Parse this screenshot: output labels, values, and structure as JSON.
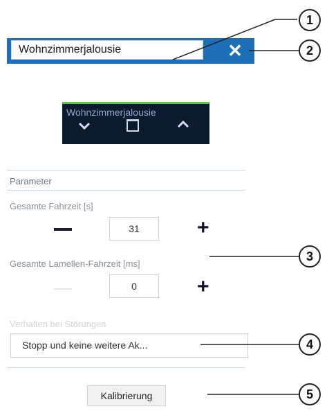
{
  "header": {
    "name_value": "Wohnzimmerjalousie",
    "close_symbol": "✕",
    "bar_color": "#1e6fb8"
  },
  "preview": {
    "title": "Wohnzimmerjalousie",
    "icons": [
      "chevron-down-icon",
      "stop-icon",
      "chevron-up-icon"
    ],
    "accent_color": "#5ec64a"
  },
  "parameter": {
    "section_title": "Parameter",
    "total_travel": {
      "label": "Gesamte Fahrzeit [s]",
      "value": "31",
      "plus": "+"
    },
    "slat_travel": {
      "label": "Gesamte Lamellen-Fahrzeit [ms]",
      "value": "0",
      "plus": "+"
    },
    "fault_behavior": {
      "label": "Verhalten bei Störungen",
      "selected": "Stopp und keine weitere Ak..."
    },
    "calibrate_label": "Kalibrierung"
  },
  "callouts": [
    "1",
    "2",
    "3",
    "4",
    "5"
  ]
}
